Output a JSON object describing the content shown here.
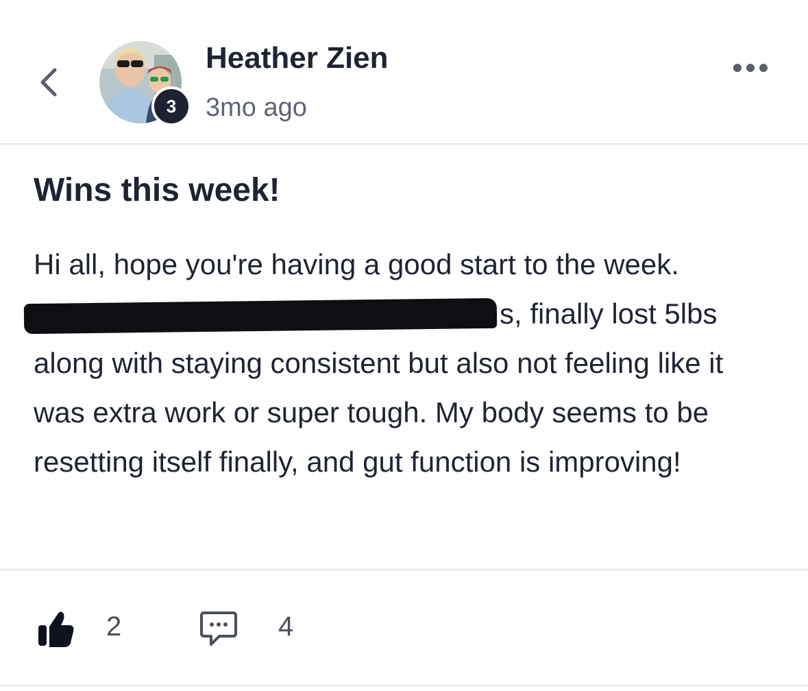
{
  "header": {
    "author_name": "Heather Zien",
    "timestamp": "3mo ago",
    "level_badge": "3"
  },
  "post": {
    "title": "Wins this week!",
    "body_line1": "Hi all, hope you're having a good start to the week.",
    "body_after_redaction": "s, finally lost 5lbs along with staying consistent but also not feeling like it was extra work or super tough. My body seems to be resetting itself finally, and gut function is improving!"
  },
  "actions": {
    "like_count": "2",
    "comment_count": "4"
  },
  "icons": {
    "back": "chevron-left-icon",
    "more": "more-horizontal-icon",
    "like": "thumbs-up-icon",
    "comment": "comment-bubble-icon"
  },
  "colors": {
    "text": "#1f2433",
    "muted": "#5f6473",
    "badge": "#1d2233",
    "divider": "#e4e5e8"
  }
}
